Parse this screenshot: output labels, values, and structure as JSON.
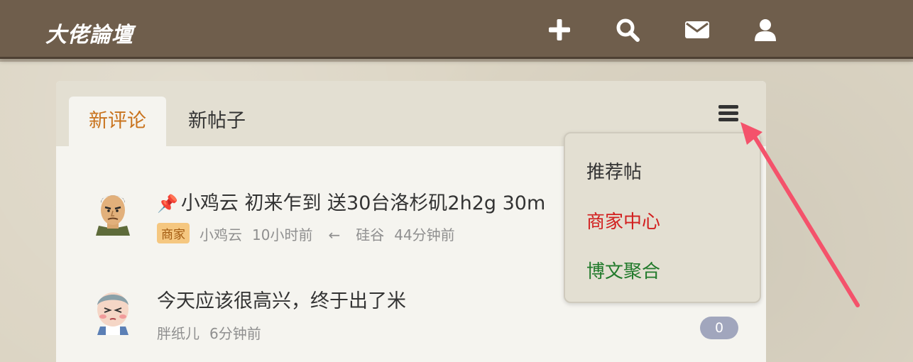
{
  "header": {
    "logo": "大佬論壇",
    "icons": {
      "new_post": "plus-icon",
      "search": "search-icon",
      "messages": "envelope-icon",
      "profile": "user-icon"
    }
  },
  "tabs": [
    {
      "label": "新评论",
      "active": true
    },
    {
      "label": "新帖子",
      "active": false
    }
  ],
  "menu_icon": "hamburger-icon",
  "posts": [
    {
      "pinned": true,
      "title": "小鸡云 初来乍到 送30台洛杉矶2h2g 30m",
      "badge": "商家",
      "author": "小鸡云",
      "time": "10小时前",
      "reply_arrow": "←",
      "last_reply_user": "硅谷",
      "last_reply_time": "44分钟前"
    },
    {
      "pinned": false,
      "title": "今天应该很高兴，终于出了米",
      "author": "胖纸儿",
      "time": "6分钟前",
      "comment_count": "0"
    }
  ],
  "dropdown": {
    "items": [
      {
        "label": "推荐帖",
        "color": "#333333"
      },
      {
        "label": "商家中心",
        "color": "#d21f1f"
      },
      {
        "label": "博文聚合",
        "color": "#217a2b"
      }
    ]
  },
  "colors": {
    "header_bg": "#6f5e4c",
    "active_tab": "#c9731d",
    "annotation_arrow": "#f4526b"
  }
}
